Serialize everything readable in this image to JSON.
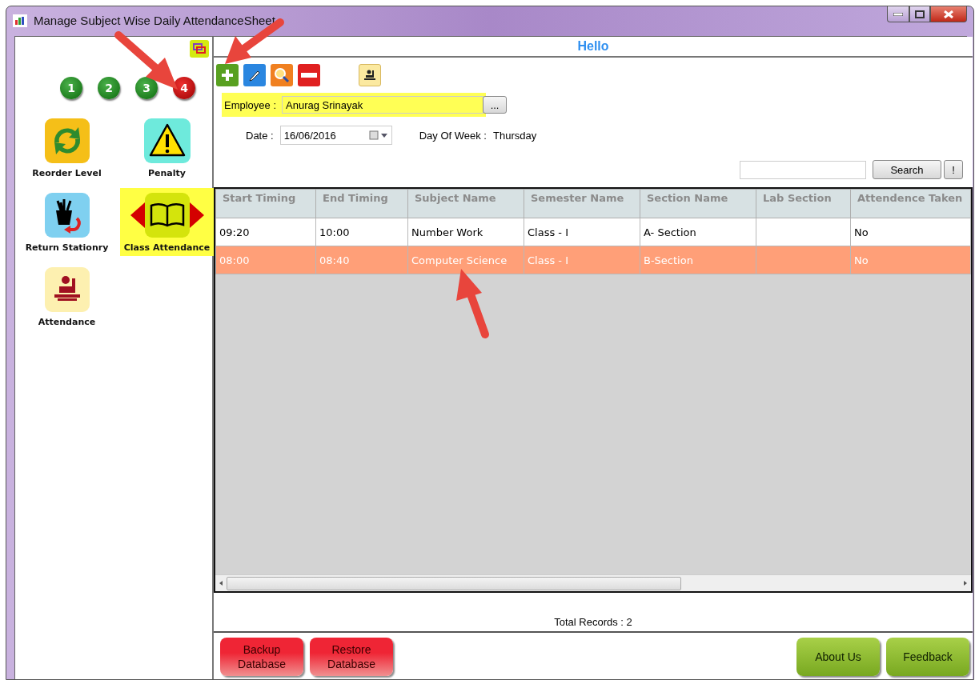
{
  "window": {
    "title": "Manage Subject Wise Daily AttendanceSheet"
  },
  "sidebar": {
    "steps": [
      {
        "label": "1",
        "selected": false
      },
      {
        "label": "2",
        "selected": false
      },
      {
        "label": "3",
        "selected": false
      },
      {
        "label": "4",
        "selected": true
      }
    ],
    "items": [
      {
        "label": "Reorder Level",
        "kind": "reorder",
        "selected": false
      },
      {
        "label": "Penalty",
        "kind": "penalty",
        "selected": false
      },
      {
        "label": "Return Stationry",
        "kind": "stationery",
        "selected": false
      },
      {
        "label": "Class Attendance",
        "kind": "book",
        "selected": true
      },
      {
        "label": "Attendance",
        "kind": "attendance",
        "selected": false
      }
    ]
  },
  "header": {
    "title": "Hello"
  },
  "form": {
    "employee_label": "Employee :",
    "employee": "Anurag Srinayak",
    "employee_highlighted": true,
    "browse_button": "...",
    "date_label": "Date :",
    "date": "16/06/2016",
    "day_label": "Day Of Week :",
    "day": "Thursday",
    "search_button": "Search",
    "help_button": "!"
  },
  "table": {
    "columns": [
      "Start Timing",
      "End Timing",
      "Subject Name",
      "Semester Name",
      "Section Name",
      "Lab Section",
      "Attendence Taken"
    ],
    "rows": [
      {
        "cells": [
          "09:20",
          "10:00",
          "Number Work",
          "Class - I",
          "A- Section",
          "",
          "No"
        ],
        "selected": false
      },
      {
        "cells": [
          "08:00",
          "08:40",
          "Computer Science",
          "Class - I",
          "B-Section",
          "",
          "No"
        ],
        "selected": true
      }
    ]
  },
  "footer": {
    "total": "Total Records : 2"
  },
  "buttons": [
    {
      "label": "Backup Database",
      "kind": "danger"
    },
    {
      "label": "Restore Database",
      "kind": "danger"
    },
    {
      "label": "About Us",
      "kind": "info"
    },
    {
      "label": "Feedback",
      "kind": "info"
    }
  ]
}
